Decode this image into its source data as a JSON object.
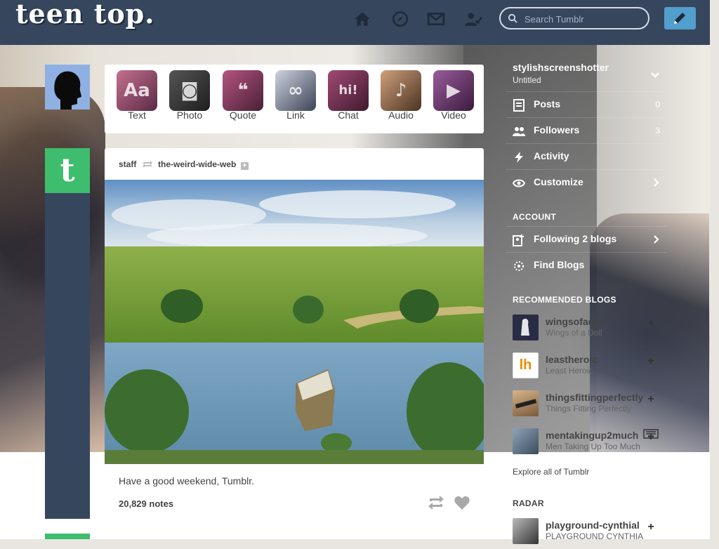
{
  "header": {
    "logo": "teen top.",
    "search_placeholder": "Search Tumblr",
    "nav_icons": [
      "home-icon",
      "explore-icon",
      "inbox-icon",
      "account-icon"
    ],
    "compose_icon": "pencil-icon"
  },
  "post_types": [
    {
      "label": "Text",
      "glyph": "Aa",
      "color": "#8a4a6e"
    },
    {
      "label": "Photo",
      "glyph": "◙",
      "color": "#3b3a3a"
    },
    {
      "label": "Quote",
      "glyph": "❝",
      "color": "#7a2f55"
    },
    {
      "label": "Link",
      "glyph": "∞",
      "color": "#4a4f66"
    },
    {
      "label": "Chat",
      "glyph": "hi!",
      "color": "#6c3350"
    },
    {
      "label": "Audio",
      "glyph": "♪",
      "color": "#7a5a3f"
    },
    {
      "label": "Video",
      "glyph": "▶",
      "color": "#5a2d5c"
    }
  ],
  "post": {
    "author": "staff",
    "reblogged_from": "the-weird-wide-web",
    "caption": "Have a good weekend, Tumblr.",
    "notes": "20,829 notes"
  },
  "sidebar": {
    "username": "stylishscreenshotter",
    "blog_title": "Untitled",
    "menu": [
      {
        "label": "Posts",
        "count": "0",
        "icon": "posts-icon"
      },
      {
        "label": "Followers",
        "count": "3",
        "icon": "followers-icon"
      },
      {
        "label": "Activity",
        "count": "",
        "icon": "activity-icon"
      },
      {
        "label": "Customize",
        "count": "",
        "icon": "customize-icon"
      }
    ],
    "account_heading": "ACCOUNT",
    "account_items": [
      {
        "label": "Following 2 blogs",
        "icon": "following-icon"
      },
      {
        "label": "Find Blogs",
        "icon": "find-blogs-icon"
      }
    ],
    "recommended_heading": "RECOMMENDED BLOGS",
    "recommended": [
      {
        "name": "wingsofadoil",
        "desc": "Wings of a Doll",
        "color": "#2a2c46"
      },
      {
        "name": "leastheroic",
        "desc": "Least Heroic",
        "color": "#ffffff"
      },
      {
        "name": "thingsfittingperfectly",
        "desc": "Things Fitting Perfectly",
        "color": "#b09070"
      },
      {
        "name": "mentakingup2much",
        "desc": "Men Taking Up Too Much",
        "color": "#6a7c90"
      }
    ],
    "explore_link": "Explore all of Tumblr",
    "radar_heading": "RADAR",
    "radar": {
      "name": "playground-cynthial",
      "desc": "PLAYGROUND CYNTHIA"
    }
  }
}
